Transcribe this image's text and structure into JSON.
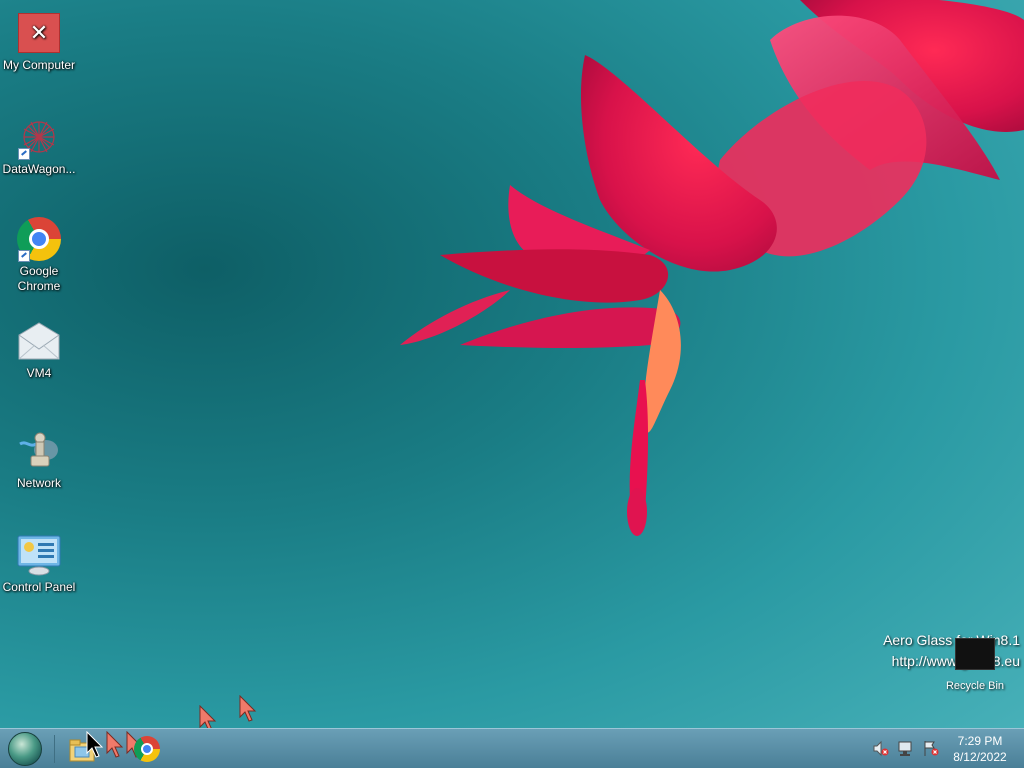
{
  "desktop": {
    "icons": [
      {
        "label": "My Computer",
        "icon": "error-x-icon"
      },
      {
        "label": "DataWagon...",
        "icon": "datawagon-icon"
      },
      {
        "label": "Google Chrome",
        "icon": "chrome-icon"
      },
      {
        "label": "VM4",
        "icon": "envelope-icon"
      },
      {
        "label": "Network",
        "icon": "network-icon"
      },
      {
        "label": "Control Panel",
        "icon": "control-panel-icon"
      }
    ],
    "watermark": {
      "line1": "Aero Glass for Win8.1",
      "line2": "http://www.glass8.eu"
    },
    "recycle_bin": {
      "label": "Recycle Bin"
    }
  },
  "taskbar": {
    "start": "start-orb",
    "pinned": [
      "file-explorer-icon",
      "chrome-icon"
    ],
    "tray": [
      "volume-muted-icon",
      "network-tray-icon",
      "action-center-flag-icon"
    ],
    "time": "7:29 PM",
    "date": "8/12/2022"
  },
  "colors": {
    "accent": "#4a7f97",
    "error_red": "#d64545"
  }
}
